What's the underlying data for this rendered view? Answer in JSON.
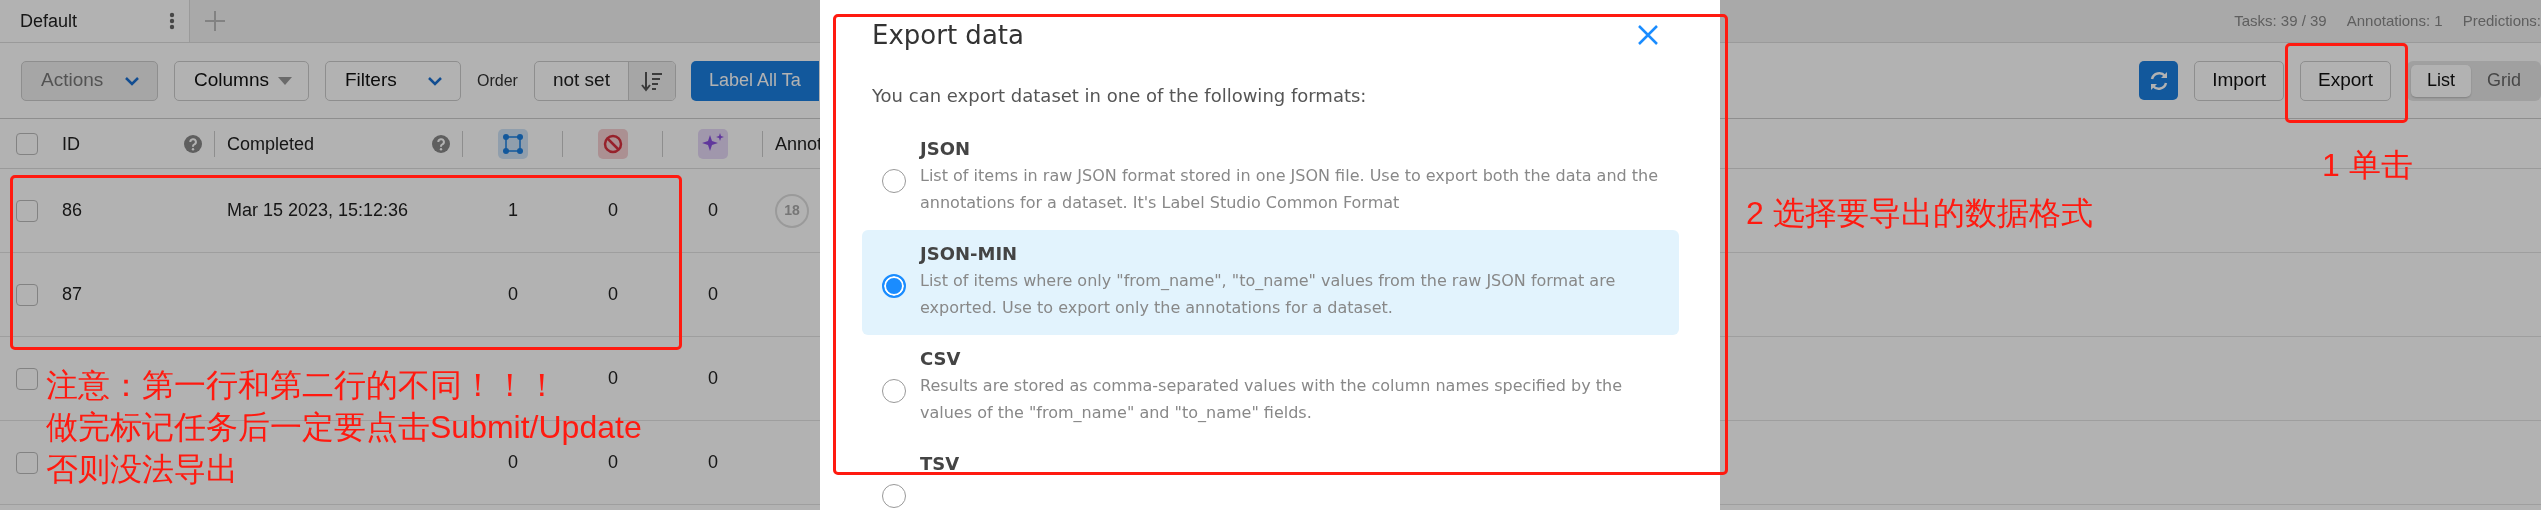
{
  "tabs": [
    {
      "label": "Default",
      "selected": true
    }
  ],
  "stats": [
    "Tasks: 39 / 39",
    "Annotations: 1",
    "Predictions:"
  ],
  "toolbar": {
    "actions": "Actions",
    "columns": "Columns",
    "filters": "Filters",
    "order_label": "Order",
    "order_value": "not set",
    "label_all": "Label All Ta",
    "import": "Import",
    "export": "Export",
    "view_toggle": [
      {
        "label": "List",
        "selected": true
      },
      {
        "label": "Grid",
        "selected": false
      }
    ]
  },
  "table": {
    "columns": [
      {
        "label": "ID",
        "kind": "text",
        "help": true
      },
      {
        "label": "Completed",
        "kind": "text",
        "help": true
      },
      {
        "kind": "box"
      },
      {
        "kind": "ban"
      },
      {
        "kind": "sparkle"
      },
      {
        "label": "Annot",
        "kind": "text",
        "help": false
      }
    ],
    "select_all_checked": false,
    "rows": [
      {
        "id": "86",
        "completed": "Mar 15 2023, 15:12:36",
        "column_3": "1",
        "column_4": "0",
        "column_5": "0",
        "annotator": "18",
        "checked": false
      },
      {
        "id": "87",
        "column_3": "0",
        "column_4": "0",
        "column_5": "0",
        "checked": false
      },
      {
        "column_4": "0",
        "column_5": "0",
        "checked": false
      },
      {
        "column_3": "0",
        "column_4": "0",
        "column_5": "0",
        "checked": false
      }
    ]
  },
  "dialog": {
    "title": "Export data",
    "intro": "You can export dataset in one of the following formats:",
    "formats": [
      {
        "name": "JSON",
        "description": "List of items in raw JSON format stored in one JSON file. Use to export both the data and the annotations for a dataset. It's Label Studio Common Format",
        "selected": false
      },
      {
        "name": "JSON-MIN",
        "description": "List of items where only \"from_name\", \"to_name\" values from the raw JSON format are exported. Use to export only the annotations for a dataset.",
        "selected": true
      },
      {
        "name": "CSV",
        "description": "Results are stored as comma-separated values with the column names specified by the values of the \"from_name\" and \"to_name\" fields.",
        "selected": false
      },
      {
        "name": "TSV",
        "selected": false
      }
    ]
  },
  "callouts": [
    {
      "text": "1 单击"
    },
    {
      "text": "2 选择要导出的数据格式"
    },
    {
      "text": "注意：第一行和第二行的不同！！！"
    },
    {
      "text": "做完标记任务后一定要点击Submit/Update"
    },
    {
      "text": "否则没法导出"
    }
  ]
}
